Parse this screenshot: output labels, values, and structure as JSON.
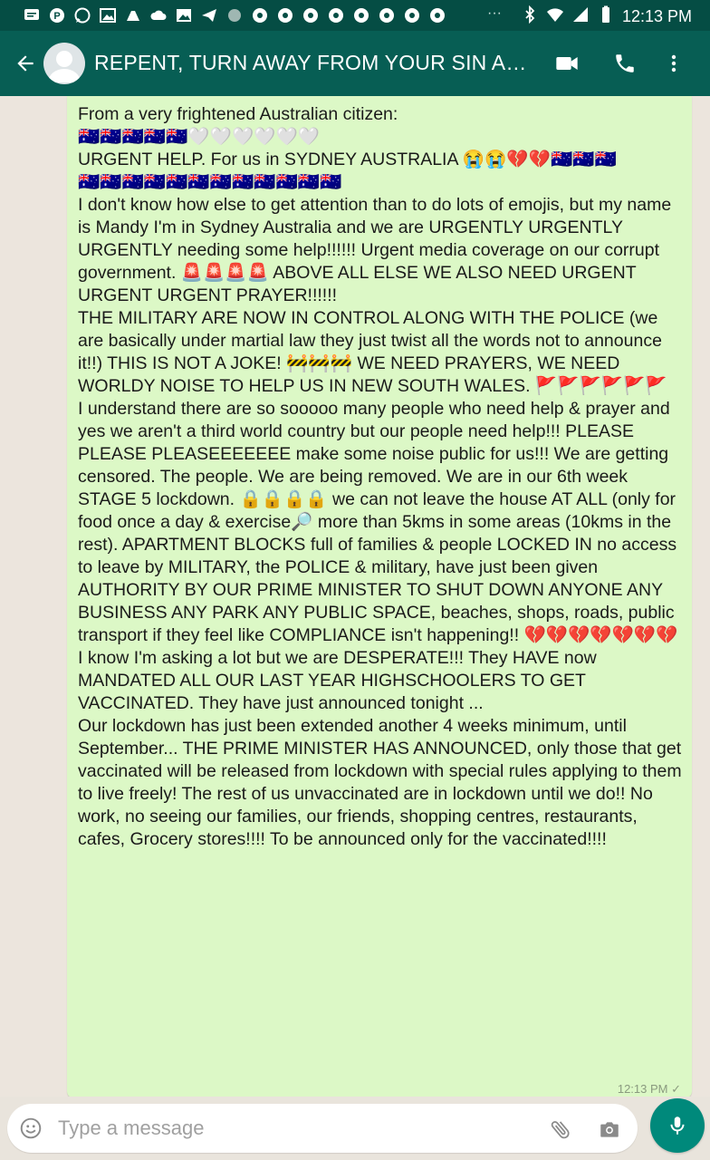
{
  "status_bar": {
    "time": "12:13 PM",
    "more_indicator": "···",
    "icons": [
      "message-icon",
      "pinterest-icon",
      "whatsapp-icon",
      "gallery-icon",
      "robot-icon",
      "cloud-icon",
      "image-icon",
      "telegram-icon",
      "dot-icon",
      "record-icon",
      "record-icon",
      "record-icon",
      "record-icon",
      "record-icon",
      "record-icon",
      "record-icon",
      "record-icon",
      "bluetooth-icon",
      "wifi-icon",
      "signal-icon",
      "battery-icon"
    ]
  },
  "header": {
    "title": "REPENT, TURN AWAY FROM YOUR SIN AND...",
    "color": "#075e54"
  },
  "message": {
    "paragraphs": [
      "From a very frightened Australian citizen:",
      "",
      "🇦🇺🇦🇺🇦🇺🇦🇺🇦🇺🤍🤍🤍🤍🤍🤍",
      "URGENT HELP. For us in SYDNEY AUSTRALIA 😭😭💔💔🇦🇺🇦🇺🇦🇺",
      "🇦🇺🇦🇺🇦🇺🇦🇺🇦🇺🇦🇺🇦🇺🇦🇺🇦🇺🇦🇺🇦🇺🇦🇺",
      "",
      "I don't know how else to get attention than to do lots of emojis, but my name is Mandy I'm in Sydney Australia and we are URGENTLY URGENTLY URGENTLY needing some help!!!!!! Urgent media coverage on our corrupt government. 🚨🚨🚨🚨 ABOVE ALL ELSE WE ALSO NEED URGENT URGENT URGENT PRAYER!!!!!!",
      "",
      "THE MILITARY ARE NOW IN CONTROL ALONG WITH THE POLICE (we are basically under martial law they just twist all the words not to announce it!!) THIS IS NOT A JOKE! 🚧🚧🚧 WE NEED PRAYERS, WE NEED WORLDY NOISE TO HELP US IN NEW SOUTH WALES. 🚩🚩🚩🚩🚩🚩",
      "I understand there are so sooooo many people who need help & prayer and yes we aren't a third world country but our people need help!!! PLEASE PLEASE PLEASEEEEEEE make some noise public for us!!! We are getting censored. The people. We are being removed. We are in our 6th week STAGE 5 lockdown. 🔒🔒🔒🔒 we can not leave the house AT ALL (only for food once a day & exercise🔎 more than 5kms in some areas (10kms in the rest). APARTMENT BLOCKS full of families & people LOCKED IN no access to leave by MILITARY, the POLICE & military, have just been given AUTHORITY BY OUR PRIME MINISTER TO SHUT DOWN ANYONE ANY BUSINESS ANY PARK ANY PUBLIC SPACE, beaches, shops, roads, public transport if they feel like COMPLIANCE isn't happening!! 💔💔💔💔💔💔💔 I know I'm asking a lot but we are DESPERATE!!! They HAVE now MANDATED ALL OUR LAST YEAR HIGHSCHOOLERS TO GET VACCINATED. They have just announced tonight ...",
      "",
      "Our lockdown has just been extended another 4 weeks minimum, until September... THE PRIME MINISTER HAS ANNOUNCED, only those that get vaccinated will be released from lockdown with special rules applying to them to live freely! The rest of us unvaccinated are in lockdown until we do!! No work, no seeing our families, our friends, shopping centres, restaurants, cafes, Grocery stores!!!! To be announced only for the vaccinated!!!!"
    ],
    "time": "12:13 PM ✓",
    "bubble_color": "#dcf8c6"
  },
  "input": {
    "placeholder": "Type a message"
  },
  "colors": {
    "accent": "#00897b",
    "chat_bg": "#ece5dd"
  }
}
